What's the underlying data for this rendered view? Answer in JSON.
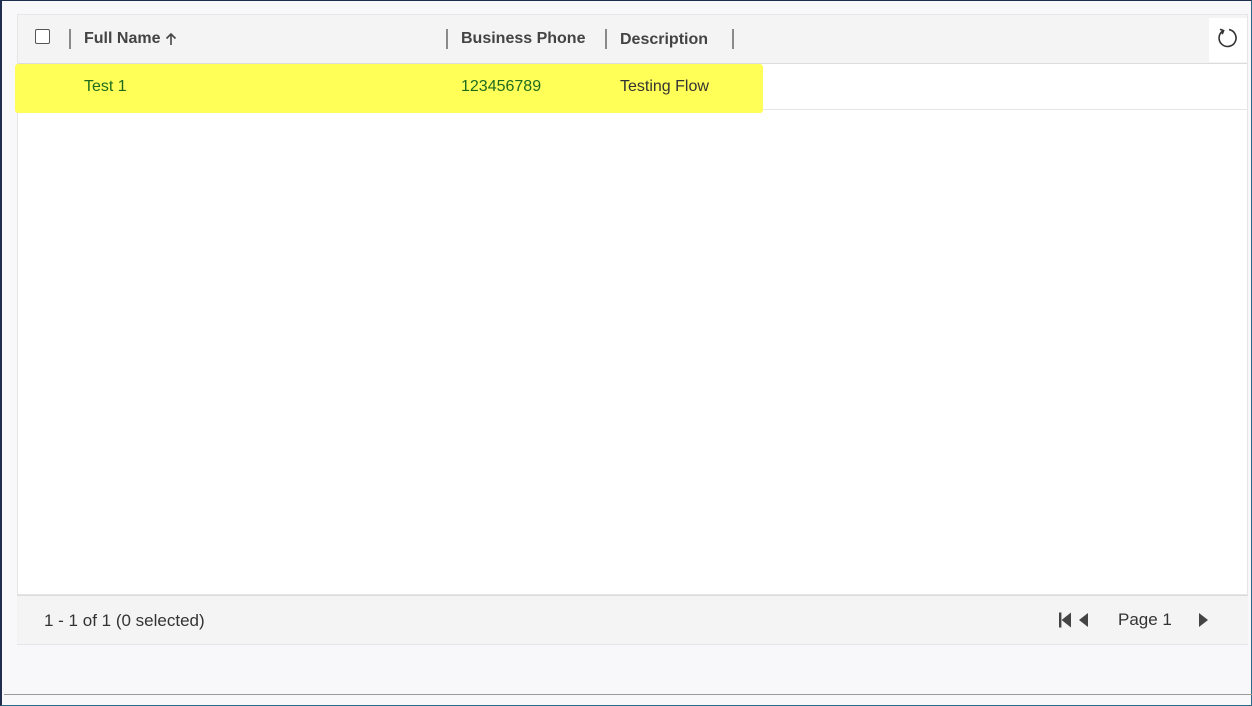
{
  "grid": {
    "columns": [
      {
        "label": "Full Name",
        "sort": "ascending"
      },
      {
        "label": "Business Phone"
      },
      {
        "label": "Description"
      }
    ],
    "rows": [
      {
        "full_name": "Test 1",
        "business_phone": "123456789",
        "description": "Testing Flow",
        "highlighted": true
      }
    ],
    "icons": {
      "select_all": "checkbox-icon",
      "sort": "arrow-up-icon",
      "refresh": "refresh-icon"
    },
    "colors": {
      "highlight": "#ffff57",
      "link": "#1e6b1e"
    }
  },
  "footer": {
    "record_count": "1 - 1 of 1 (0 selected)",
    "page_label": "Page 1",
    "icons": {
      "first": "first-page-icon",
      "previous": "previous-page-icon",
      "next": "next-page-icon"
    }
  }
}
